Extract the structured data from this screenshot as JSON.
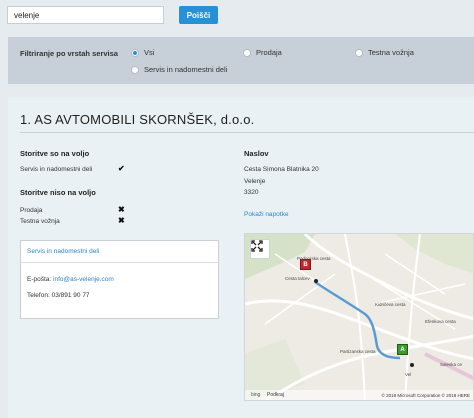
{
  "search": {
    "value": "velenje",
    "button_label": "Poišči"
  },
  "filter": {
    "label": "Filtriranje po vrstah servisa",
    "options": [
      {
        "label": "Vsi",
        "selected": true
      },
      {
        "label": "Prodaja",
        "selected": false
      },
      {
        "label": "Testna vožnja",
        "selected": false
      },
      {
        "label": "Servis in nadomestni deli",
        "selected": false
      }
    ]
  },
  "dealer": {
    "title": "1. AS AVTOMOBILI SKORNŠEK, d.o.o.",
    "available_heading": "Storitve so na voljo",
    "available": [
      {
        "label": "Servis in nadomestni deli",
        "mark": "✔"
      }
    ],
    "unavailable_heading": "Storitve niso na voljo",
    "unavailable": [
      {
        "label": "Prodaja",
        "mark": "✖"
      },
      {
        "label": "Testna vožnja",
        "mark": "✖"
      }
    ],
    "contact": {
      "header": "Servis in nadomestni deli",
      "email_label": "E-pošta:",
      "email": "info@as-velenje.com",
      "phone_label": "Telefon:",
      "phone": "03/891 90 77"
    },
    "address": {
      "heading": "Naslov",
      "street": "Cesta Simona Blatnika 20",
      "city": "Velenje",
      "postcode": "3320",
      "directions_link": "Pokaži napotke"
    }
  },
  "map": {
    "pin_a": "A",
    "pin_b": "B",
    "labels": [
      "Podgorska cesta",
      "Cesta talcev",
      "Kidričeva cesta",
      "Efenkova cesta",
      "Partizanska cesta",
      "Saleska ce",
      "Vel"
    ],
    "attribution": "© 2018 Microsoft Corporation © 2018 HERE",
    "bing": "bing",
    "region": "Podkraj",
    "route_color": "#5b9bd5"
  },
  "colors": {
    "accent": "#2790d6",
    "link": "#2a86c8",
    "filter_bg": "#c7d0d8",
    "card_bg": "#eaf1f5"
  }
}
